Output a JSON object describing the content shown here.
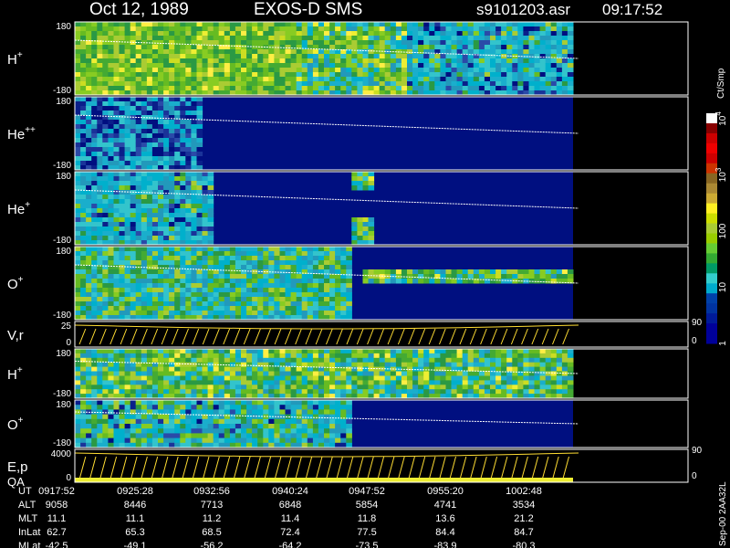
{
  "header": {
    "date": "Oct 12, 1989",
    "instrument": "EXOS-D SMS",
    "file": "s9101203.asr",
    "time": "09:17:52"
  },
  "chart_data": {
    "type": "heatmap",
    "panels": [
      {
        "label": "H",
        "superscript": "+",
        "ymax": "180",
        "ymin": "-180",
        "kind": "spectrogram"
      },
      {
        "label": "He",
        "superscript": "++",
        "ymax": "180",
        "ymin": "-180",
        "kind": "spectrogram"
      },
      {
        "label": "He",
        "superscript": "+",
        "ymax": "180",
        "ymin": "-180",
        "kind": "spectrogram"
      },
      {
        "label": "O",
        "superscript": "+",
        "ymax": "180",
        "ymin": "-180",
        "kind": "spectrogram"
      },
      {
        "label": "V,r",
        "superscript": "",
        "ymax": "25",
        "ymin": "0",
        "kind": "line",
        "right_top": "90",
        "right_bottom": "0"
      },
      {
        "label": "H",
        "superscript": "+",
        "ymax": "180",
        "ymin": "-180",
        "kind": "spectrogram"
      },
      {
        "label": "O",
        "superscript": "+",
        "ymax": "180",
        "ymin": "-180",
        "kind": "spectrogram"
      },
      {
        "label": "E,p",
        "label2": "QA",
        "superscript": "",
        "ymax": "4000",
        "ymin": "0",
        "kind": "line",
        "right_top": "90",
        "right_bottom": "0"
      }
    ],
    "colorbar": {
      "unit": "Ct/Smp",
      "ticks": [
        {
          "label": "1",
          "value": 1
        },
        {
          "label": "10",
          "value": 10
        },
        {
          "label": "100",
          "value": 100
        },
        {
          "label": "10",
          "sup": "3",
          "value": 1000
        },
        {
          "label": "10",
          "sup": "4",
          "value": 10000
        }
      ],
      "colors": [
        "#000099",
        "#000099",
        "#001a99",
        "#0033a0",
        "#0040a8",
        "#00aacc",
        "#33cccc",
        "#009966",
        "#33aa33",
        "#66cc33",
        "#99cc00",
        "#aacc33",
        "#ccdd00",
        "#ffee22",
        "#ccaa33",
        "#aa8833",
        "#886622",
        "#cc3300",
        "#cc0000",
        "#ee0000",
        "#cc0000",
        "#880000",
        "#ffffff"
      ]
    },
    "orbit_table": {
      "rows": [
        {
          "name": "UT",
          "values": [
            "0917:52",
            "0925:28",
            "0932:56",
            "0940:24",
            "0947:52",
            "0955:20",
            "1002:48"
          ]
        },
        {
          "name": "ALT",
          "values": [
            "9058",
            "8446",
            "7713",
            "6848",
            "5854",
            "4741",
            "3534"
          ]
        },
        {
          "name": "MLT",
          "values": [
            "11.1",
            "11.1",
            "11.2",
            "11.4",
            "11.8",
            "13.6",
            "21.2"
          ]
        },
        {
          "name": "InLat",
          "values": [
            "62.7",
            "65.3",
            "68.5",
            "72.4",
            "77.5",
            "84.4",
            "84.7"
          ]
        },
        {
          "name": "MLat",
          "values": [
            "-42.5",
            "-49.1",
            "-56.2",
            "-64.2",
            "-73.5",
            "-83.9",
            "-80.3"
          ]
        }
      ]
    },
    "footer_note": "Sep-00 2AA32L"
  },
  "colors": {
    "background": "#000000",
    "axis": "#ffffff",
    "title": "#ffffff",
    "trace": "#ffffff",
    "line_trace": "#ffdd33"
  }
}
